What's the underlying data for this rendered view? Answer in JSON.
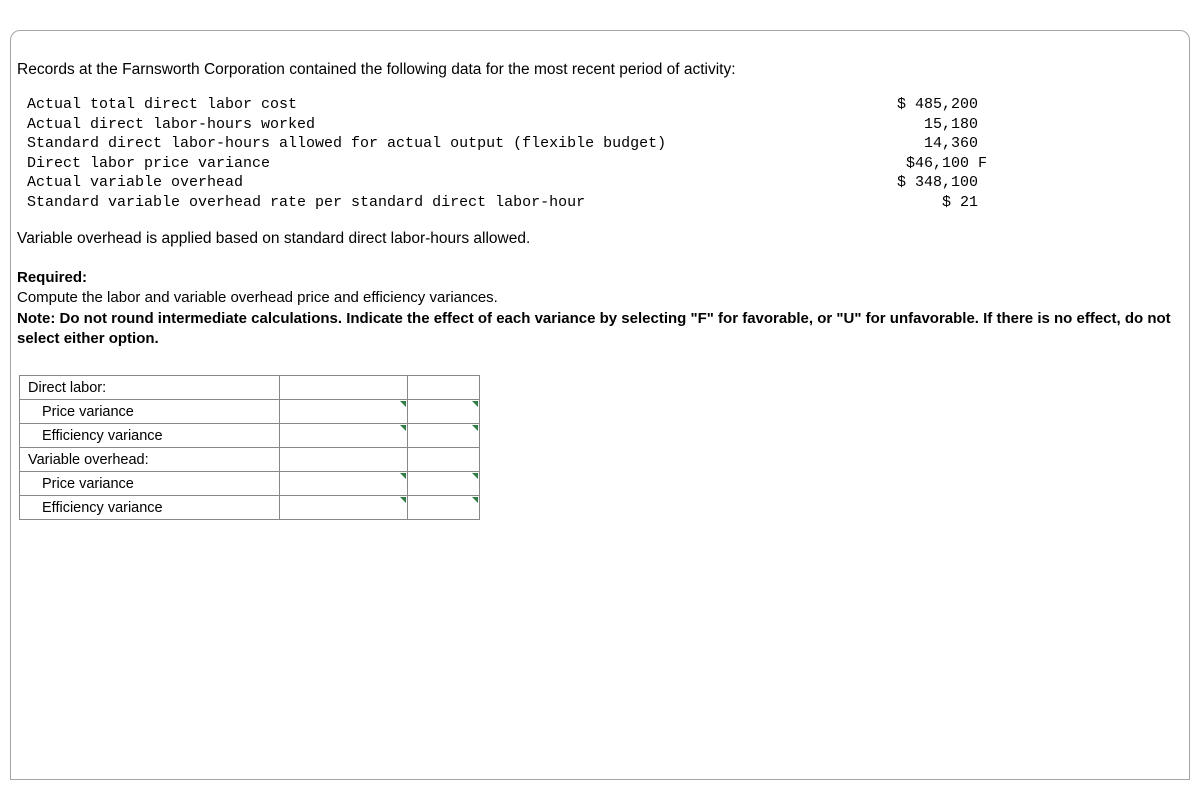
{
  "intro": "Records at the Farnsworth Corporation contained the following data for the most recent period of activity:",
  "data_rows": [
    {
      "label": "Actual total direct labor cost",
      "value": "$ 485,200 "
    },
    {
      "label": "Actual direct labor-hours worked",
      "value": "15,180 "
    },
    {
      "label": "Standard direct labor-hours allowed for actual output (flexible budget)",
      "value": "14,360 "
    },
    {
      "label": "Direct labor price variance",
      "value": "$46,100 F"
    },
    {
      "label": "Actual variable overhead",
      "value": "$ 348,100 "
    },
    {
      "label": "Standard variable overhead rate per standard direct labor-hour",
      "value": "$ 21 "
    }
  ],
  "applied_note": "Variable overhead is applied based on standard direct labor-hours allowed.",
  "required": {
    "title": "Required:",
    "line1": "Compute the labor and variable overhead price and efficiency variances.",
    "note": "Note: Do not round intermediate calculations. Indicate the effect of each variance by selecting \"F\" for favorable, or \"U\" for unfavorable. If there is no effect, do not select either option."
  },
  "answer_table": {
    "section1": "Direct labor:",
    "row_dl_price": "Price variance",
    "row_dl_eff": "Efficiency variance",
    "section2": "Variable overhead:",
    "row_vo_price": "Price variance",
    "row_vo_eff": "Efficiency variance"
  }
}
